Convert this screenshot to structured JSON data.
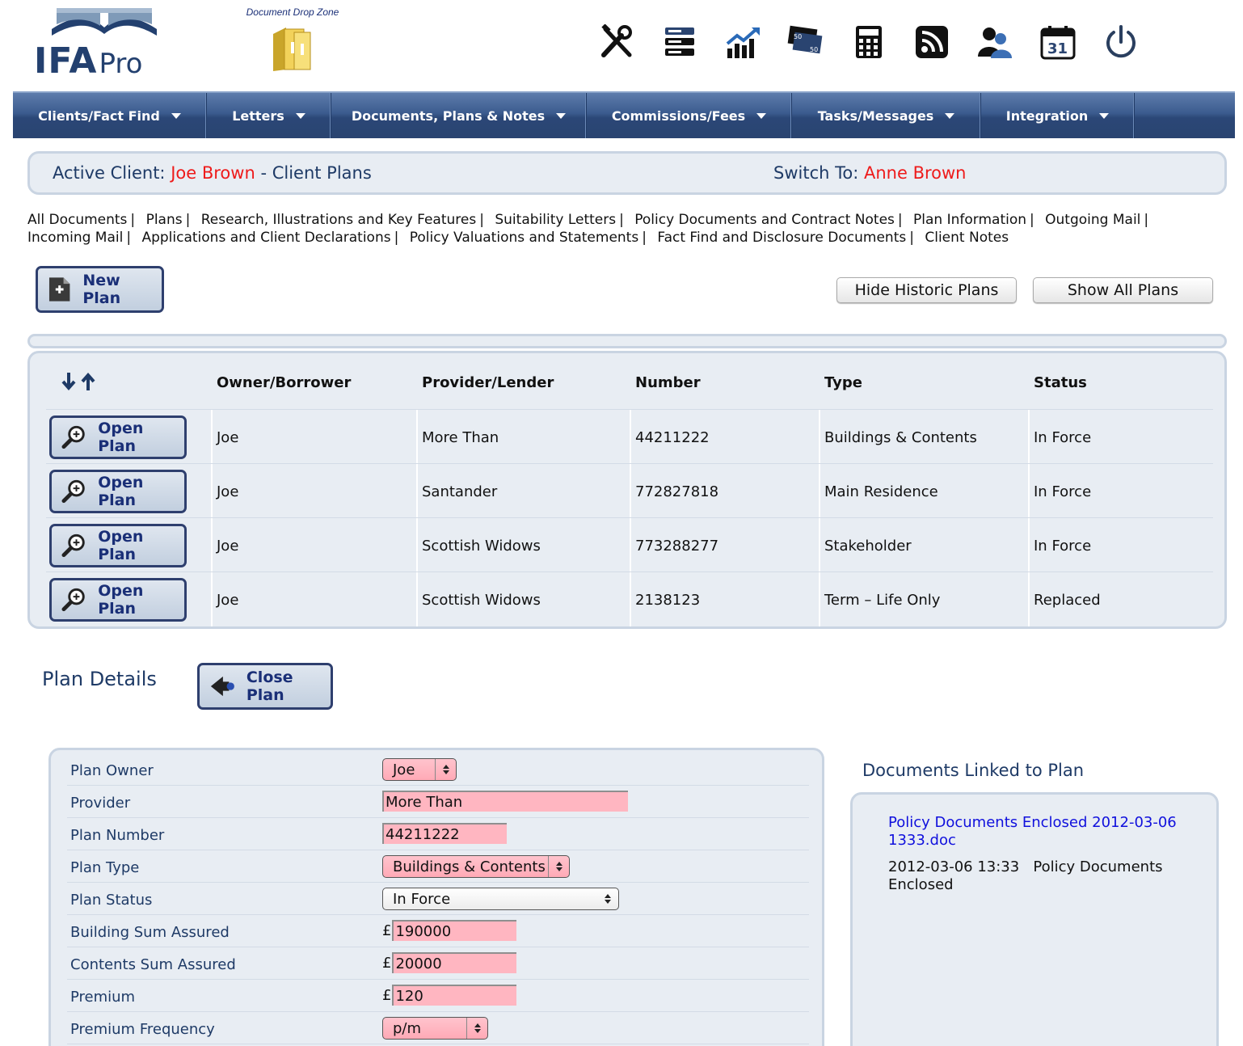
{
  "header": {
    "logo_main": "IFA",
    "logo_sub": "Pro",
    "dropzone_label": "Document Drop Zone"
  },
  "nav": [
    {
      "label": "Clients/Fact Find"
    },
    {
      "label": "Letters"
    },
    {
      "label": "Documents, Plans & Notes"
    },
    {
      "label": "Commissions/Fees"
    },
    {
      "label": "Tasks/Messages"
    },
    {
      "label": "Integration"
    }
  ],
  "client_bar": {
    "active_label": "Active Client:",
    "active_name": "Joe Brown",
    "section": "- Client Plans",
    "switch_label": "Switch To:",
    "switch_name": "Anne Brown"
  },
  "doc_links": [
    "All Documents",
    "Plans",
    "Research, Illustrations and Key Features",
    "Suitability Letters",
    "Policy Documents and Contract Notes",
    "Plan Information",
    "Outgoing Mail",
    "Incoming Mail",
    "Applications and Client Declarations",
    "Policy Valuations and Statements",
    "Fact Find and Disclosure Documents",
    "Client Notes"
  ],
  "buttons": {
    "new_plan": "New Plan",
    "hide_historic": "Hide Historic Plans",
    "show_all": "Show All Plans",
    "close_plan": "Close Plan",
    "open_plan": "Open Plan"
  },
  "table": {
    "headers": {
      "owner": "Owner/Borrower",
      "provider": "Provider/Lender",
      "number": "Number",
      "type": "Type",
      "status": "Status"
    },
    "rows": [
      {
        "owner": "Joe",
        "provider": "More Than",
        "number": "44211222",
        "type": "Buildings & Contents",
        "status": "In Force"
      },
      {
        "owner": "Joe",
        "provider": "Santander",
        "number": "772827818",
        "type": "Main Residence",
        "status": "In Force"
      },
      {
        "owner": "Joe",
        "provider": "Scottish Widows",
        "number": "773288277",
        "type": "Stakeholder",
        "status": "In Force"
      },
      {
        "owner": "Joe",
        "provider": "Scottish Widows",
        "number": "2138123",
        "type": "Term – Life Only",
        "status": "Replaced"
      }
    ]
  },
  "plan_details": {
    "title": "Plan Details",
    "currency": "£",
    "fields": {
      "owner": {
        "label": "Plan Owner",
        "value": "Joe"
      },
      "provider": {
        "label": "Provider",
        "value": "More Than"
      },
      "number": {
        "label": "Plan Number",
        "value": "44211222"
      },
      "type": {
        "label": "Plan Type",
        "value": "Buildings & Contents"
      },
      "status": {
        "label": "Plan Status",
        "value": "In Force"
      },
      "building_sum": {
        "label": "Building Sum Assured",
        "value": "190000"
      },
      "contents_sum": {
        "label": "Contents Sum Assured",
        "value": "20000"
      },
      "premium": {
        "label": "Premium",
        "value": "120"
      },
      "frequency": {
        "label": "Premium Frequency",
        "value": "p/m"
      }
    }
  },
  "documents_panel": {
    "title": "Documents Linked to Plan",
    "link": "Policy Documents Enclosed 2012-03-06 1333.doc",
    "date": "2012-03-06 13:33",
    "category": "Policy Documents Enclosed"
  },
  "colors": {
    "brand_navy": "#23406f",
    "highlight_red": "#ee1b1b",
    "required_pink": "#ffb6c1",
    "link_blue": "#1010dd"
  },
  "icons": [
    "tools-icon",
    "server-icon",
    "growth-chart-icon",
    "money-icon",
    "calculator-icon",
    "rss-icon",
    "users-icon",
    "calendar-icon",
    "power-icon"
  ]
}
